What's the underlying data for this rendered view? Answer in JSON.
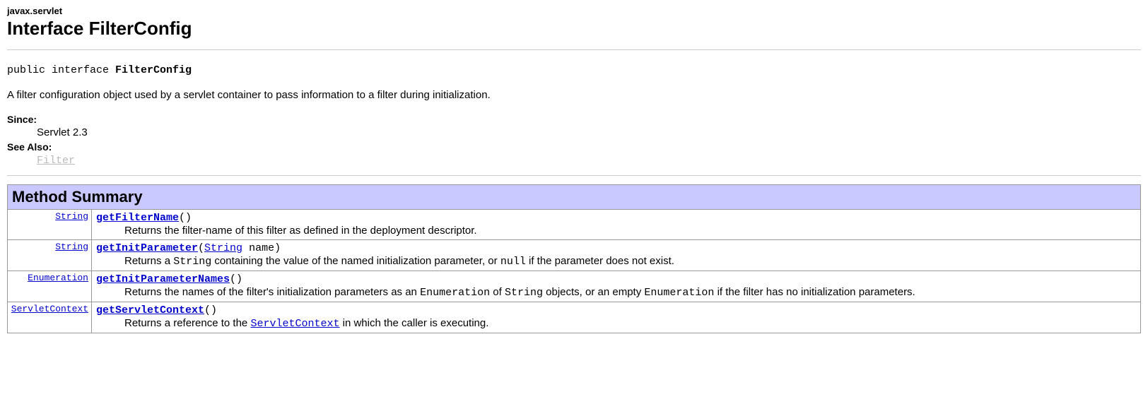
{
  "package": "javax.servlet",
  "title": "Interface FilterConfig",
  "declaration": {
    "prefix": "public interface ",
    "name": "FilterConfig"
  },
  "description": "A filter configuration object used by a servlet container to pass information to a filter during initialization.",
  "since_label": "Since:",
  "since_value": "Servlet 2.3",
  "seealso_label": "See Also:",
  "seealso_link": "Filter",
  "summary_header": "Method Summary",
  "methods": [
    {
      "return_type": "String",
      "name": "getFilterName",
      "params_html": "()",
      "desc_parts": [
        {
          "t": "text",
          "v": "Returns the filter-name of this filter as defined in the deployment descriptor."
        }
      ]
    },
    {
      "return_type": "String",
      "name": "getInitParameter",
      "params_html": "(String name)",
      "param_link": "String",
      "param_rest": " name)",
      "desc_parts": [
        {
          "t": "text",
          "v": "Returns a "
        },
        {
          "t": "code",
          "v": "String"
        },
        {
          "t": "text",
          "v": " containing the value of the named initialization parameter, or "
        },
        {
          "t": "code",
          "v": "null"
        },
        {
          "t": "text",
          "v": " if the parameter does not exist."
        }
      ]
    },
    {
      "return_type": "Enumeration",
      "name": "getInitParameterNames",
      "params_html": "()",
      "desc_parts": [
        {
          "t": "text",
          "v": "Returns the names of the filter's initialization parameters as an "
        },
        {
          "t": "code",
          "v": "Enumeration"
        },
        {
          "t": "text",
          "v": " of "
        },
        {
          "t": "code",
          "v": "String"
        },
        {
          "t": "text",
          "v": " objects, or an empty "
        },
        {
          "t": "code",
          "v": "Enumeration"
        },
        {
          "t": "text",
          "v": " if the filter has no initialization parameters."
        }
      ]
    },
    {
      "return_type": "ServletContext",
      "name": "getServletContext",
      "params_html": "()",
      "desc_parts": [
        {
          "t": "text",
          "v": "Returns a reference to the "
        },
        {
          "t": "link",
          "v": "ServletContext"
        },
        {
          "t": "text",
          "v": " in which the caller is executing."
        }
      ]
    }
  ]
}
